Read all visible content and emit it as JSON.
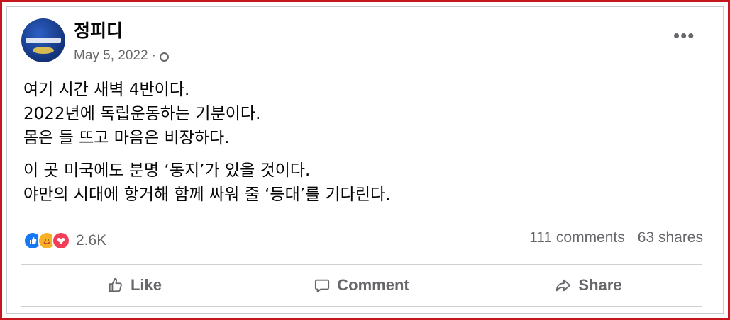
{
  "post": {
    "author": "정피디",
    "date": "May 5, 2022",
    "date_sep": "·",
    "lines": [
      "여기 시간 새벽 4반이다.",
      "2022년에 독립운동하는 기분이다.",
      "몸은 들 뜨고 마음은 비장하다.",
      "이 곳 미국에도 분명 ‘동지’가 있을 것이다.",
      "야만의 시대에 항거해 함께 싸워 줄 ‘등대’를 기다린다."
    ]
  },
  "stats": {
    "reaction_count": "2.6K",
    "comments": "111 comments",
    "shares": "63 shares",
    "reaction_icons": [
      "like-icon",
      "care-icon",
      "love-icon"
    ]
  },
  "actions": {
    "like": "Like",
    "comment": "Comment",
    "share": "Share"
  },
  "colors": {
    "frame_border": "#c4161c",
    "secondary_text": "#65676b",
    "like_blue": "#1877f2",
    "love_red": "#f33e58",
    "care_yellow": "#f7b125"
  }
}
